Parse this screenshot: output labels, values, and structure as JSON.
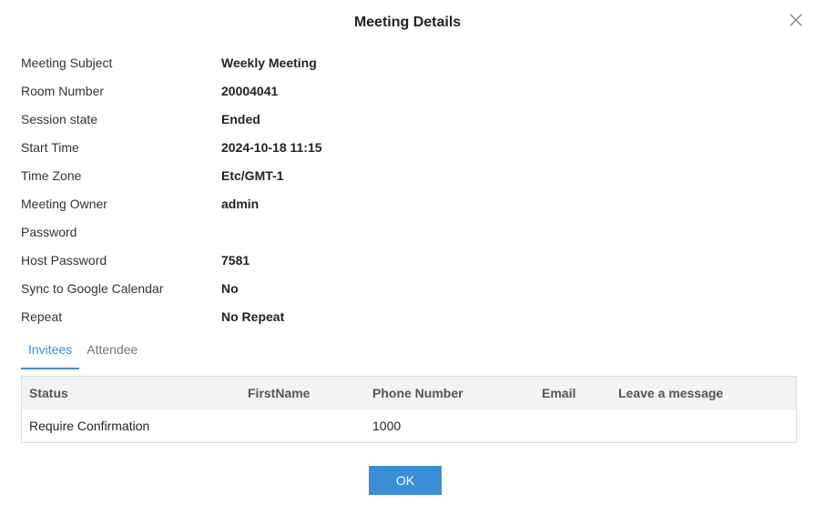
{
  "dialog": {
    "title": "Meeting Details",
    "close_icon": "close-icon"
  },
  "details": [
    {
      "label": "Meeting Subject",
      "value": "Weekly Meeting"
    },
    {
      "label": "Room Number",
      "value": "20004041"
    },
    {
      "label": "Session state",
      "value": "Ended"
    },
    {
      "label": "Start Time",
      "value": "2024-10-18 11:15"
    },
    {
      "label": "Time Zone",
      "value": "Etc/GMT-1"
    },
    {
      "label": "Meeting Owner",
      "value": "admin"
    },
    {
      "label": "Password",
      "value": ""
    },
    {
      "label": "Host Password",
      "value": "7581"
    },
    {
      "label": "Sync to Google Calendar",
      "value": "No"
    },
    {
      "label": "Repeat",
      "value": "No Repeat"
    }
  ],
  "tabs": [
    {
      "label": "Invitees",
      "active": true
    },
    {
      "label": "Attendee",
      "active": false
    }
  ],
  "table": {
    "columns": [
      "Status",
      "FirstName",
      "Phone Number",
      "Email",
      "Leave a message"
    ],
    "rows": [
      [
        "Require Confirmation",
        "",
        "1000",
        "",
        ""
      ]
    ]
  },
  "footer": {
    "ok_label": "OK"
  },
  "colors": {
    "accent": "#3b8ed8",
    "header_bg": "#f2f3f5",
    "border": "#dddddd"
  }
}
